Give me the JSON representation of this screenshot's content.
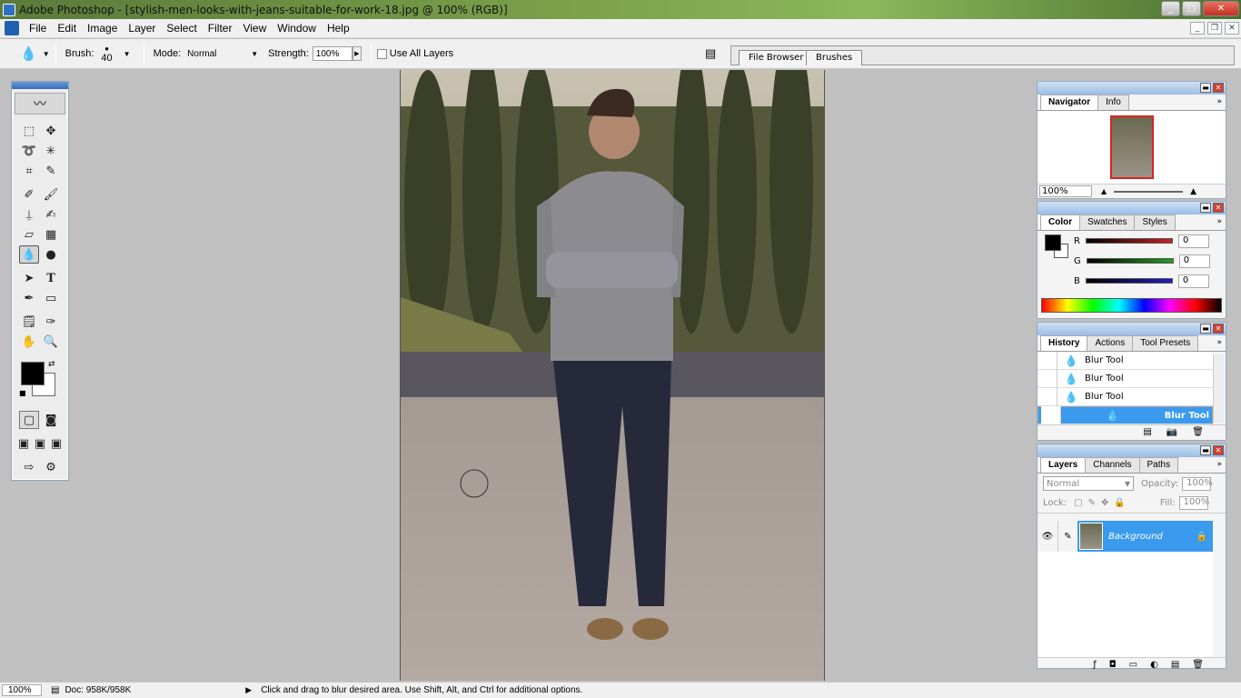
{
  "window": {
    "title": "Adobe Photoshop - [stylish-men-looks-with-jeans-suitable-for-work-18.jpg @ 100% (RGB)]"
  },
  "menu": [
    {
      "label": "File"
    },
    {
      "label": "Edit"
    },
    {
      "label": "Image"
    },
    {
      "label": "Layer"
    },
    {
      "label": "Select"
    },
    {
      "label": "Filter"
    },
    {
      "label": "View"
    },
    {
      "label": "Window"
    },
    {
      "label": "Help"
    }
  ],
  "options": {
    "brush_label": "Brush:",
    "brush_size": "40",
    "mode_label": "Mode:",
    "mode_value": "Normal",
    "strength_label": "Strength:",
    "strength_value": "100%",
    "use_all_layers": "Use All Layers"
  },
  "dock": {
    "tabs": [
      "File Browser",
      "Brushes"
    ]
  },
  "navigator": {
    "tabs": [
      "Navigator",
      "Info"
    ],
    "zoom": "100%"
  },
  "color": {
    "tabs": [
      "Color",
      "Swatches",
      "Styles"
    ],
    "channels": [
      {
        "label": "R",
        "value": "0",
        "color": "#d02020"
      },
      {
        "label": "G",
        "value": "0",
        "color": "#20a020"
      },
      {
        "label": "B",
        "value": "0",
        "color": "#2020c0"
      }
    ]
  },
  "history": {
    "tabs": [
      "History",
      "Actions",
      "Tool Presets"
    ],
    "items": [
      "Blur Tool",
      "Blur Tool",
      "Blur Tool",
      "Blur Tool"
    ]
  },
  "layers": {
    "tabs": [
      "Layers",
      "Channels",
      "Paths"
    ],
    "blend": "Normal",
    "opacity_label": "Opacity:",
    "opacity": "100%",
    "lock_label": "Lock:",
    "fill_label": "Fill:",
    "fill": "100%",
    "layer_name": "Background"
  },
  "status": {
    "zoom": "100%",
    "doc": "Doc: 958K/958K",
    "hint": "Click and drag to blur desired area. Use Shift, Alt, and Ctrl for additional options."
  },
  "colors": {
    "selection": "#3a9aee",
    "foreground": "#000000",
    "background": "#ffffff"
  }
}
